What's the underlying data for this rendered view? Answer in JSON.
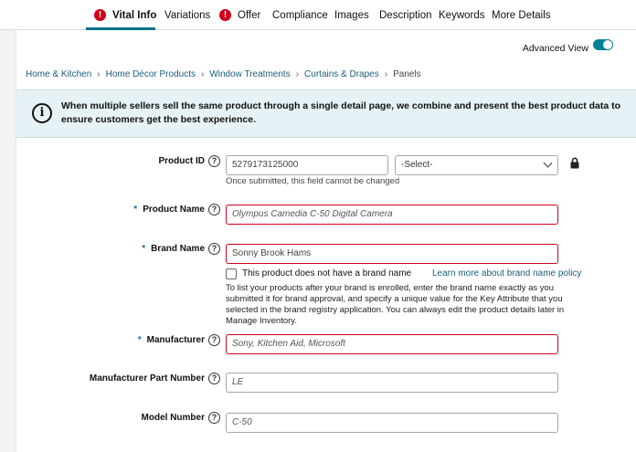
{
  "tabs": [
    {
      "label": "Vital Info",
      "error": true,
      "active": true
    },
    {
      "label": "Variations"
    },
    {
      "label": "Offer",
      "error": true
    },
    {
      "label": "Compliance"
    },
    {
      "label": "Images"
    },
    {
      "label": "Description"
    },
    {
      "label": "Keywords"
    },
    {
      "label": "More Details"
    }
  ],
  "advanced_view": {
    "label": "Advanced View",
    "enabled": true
  },
  "breadcrumb": [
    "Home & Kitchen",
    "Home Décor Products",
    "Window Treatments",
    "Curtains & Drapes",
    "Panels"
  ],
  "info_banner": "When multiple sellers sell the same product through a single detail page, we combine and present the best product data to ensure customers get the best experience.",
  "form": {
    "product_id": {
      "label": "Product ID",
      "value": "5279173125000",
      "type_placeholder": "-Select-",
      "hint": "Once submitted, this field cannot be changed"
    },
    "product_name": {
      "label": "Product Name",
      "placeholder": "Olympus Camedia C-50 Digital Camera"
    },
    "brand_name": {
      "label": "Brand Name",
      "value": "Sonny Brook Hams",
      "checkbox_label": "This product does not have a brand name",
      "policy_link": "Learn more about brand name policy",
      "note": "To list your products after your brand is enrolled, enter the brand name exactly as you submitted it for brand approval, and specify a unique value for the Key Attribute that you selected in the brand registry application. You can always edit the product details later in Manage Inventory."
    },
    "manufacturer": {
      "label": "Manufacturer",
      "placeholder": "Sony, Kitchen Aid, Microsoft"
    },
    "part_number": {
      "label": "Manufacturer Part Number",
      "placeholder": "LE"
    },
    "model_number": {
      "label": "Model Number",
      "placeholder": "C-50"
    }
  },
  "icons": {
    "help": "?",
    "info": "i",
    "error": "!"
  },
  "colors": {
    "accent": "#007185",
    "error": "#d0021b",
    "link": "#1a5f7a",
    "banner": "#e6f2f5"
  }
}
